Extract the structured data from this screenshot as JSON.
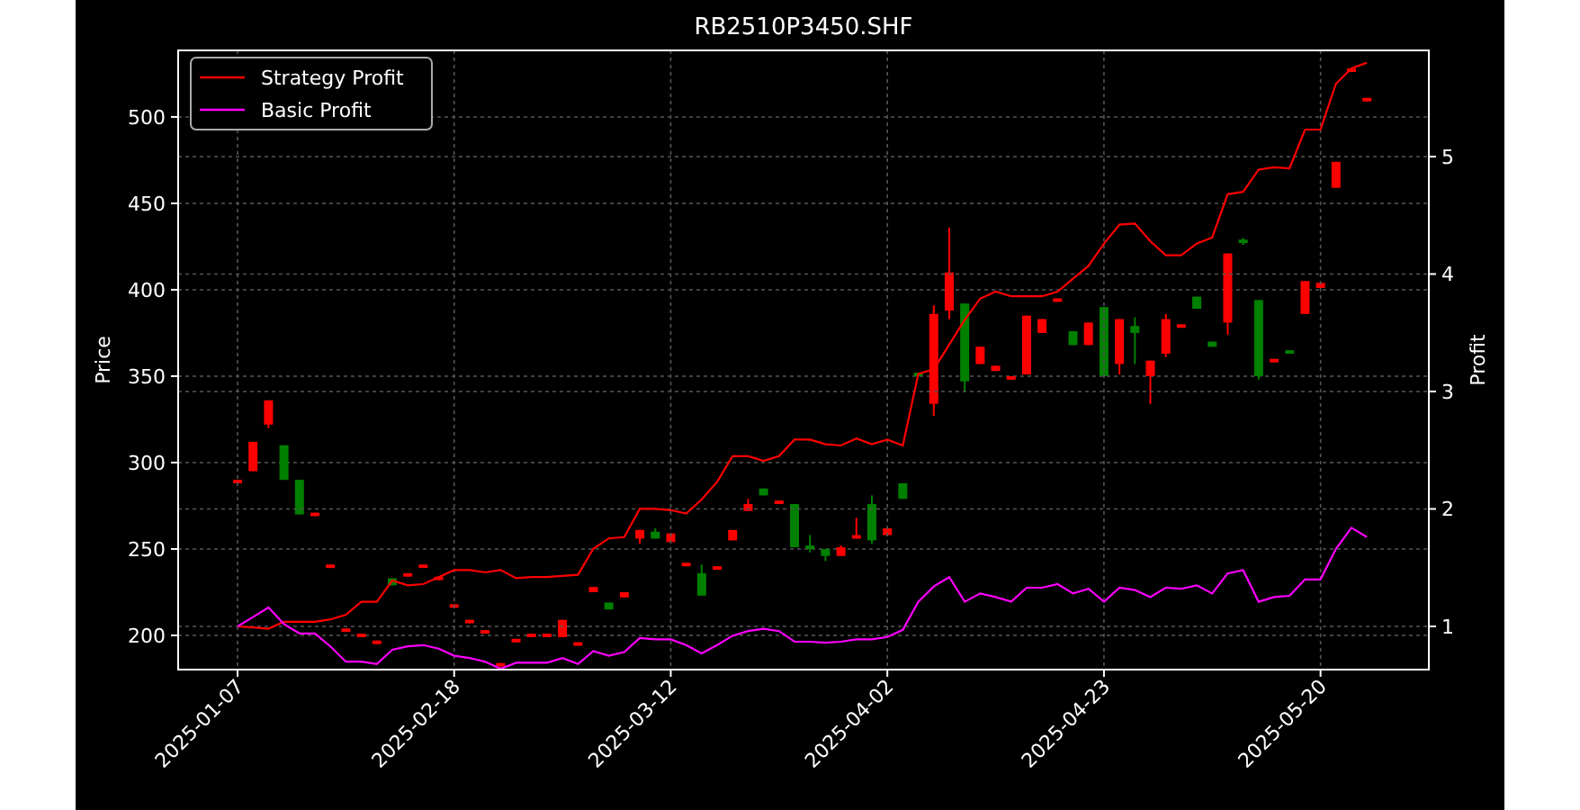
{
  "price_chart": {
    "chart_data": {
      "type": "candlestick",
      "title": "RB2510P3450.SHF",
      "ylabel": "Price",
      "grid": true,
      "categories": [
        null,
        null,
        null,
        null,
        null,
        null,
        null,
        null,
        null,
        null,
        null,
        null,
        null,
        null,
        null,
        null,
        null,
        null,
        null,
        null,
        null,
        null,
        null,
        null,
        null,
        null,
        null,
        null,
        null,
        null,
        null,
        null,
        null,
        null,
        null,
        null,
        null,
        null,
        null,
        null,
        null,
        null,
        null,
        null,
        null,
        null,
        null,
        null,
        null,
        null,
        null,
        null,
        null,
        null,
        null,
        null,
        null,
        null,
        null,
        null,
        null,
        null,
        null,
        null,
        null,
        null,
        null,
        null,
        null,
        null,
        null,
        null,
        null,
        null
      ],
      "ylim": [
        180.2,
        538.5
      ],
      "yticks": [
        200,
        250,
        300,
        350,
        400,
        450,
        500
      ],
      "ohlc": [
        [
          288,
          290,
          288,
          290
        ],
        [
          295,
          312,
          295,
          312
        ],
        [
          322,
          336,
          320,
          336
        ],
        [
          310,
          310,
          290,
          290
        ],
        [
          290,
          290,
          270,
          270
        ],
        [
          269,
          271,
          269,
          271
        ],
        [
          239,
          241,
          239,
          241
        ],
        [
          202,
          204,
          202,
          204
        ],
        [
          199,
          201,
          199,
          201
        ],
        [
          195,
          197,
          195,
          197
        ],
        [
          233,
          233,
          229,
          229
        ],
        [
          234,
          236,
          234,
          236
        ],
        [
          239,
          241,
          239,
          241
        ],
        [
          232,
          234,
          232,
          234
        ],
        [
          216,
          218,
          216,
          218
        ],
        [
          207,
          209,
          207,
          209
        ],
        [
          201,
          203,
          201,
          203
        ],
        [
          182,
          184,
          182,
          184
        ],
        [
          196,
          198,
          196,
          198
        ],
        [
          199,
          201,
          199,
          201
        ],
        [
          199,
          201,
          199,
          201
        ],
        [
          199,
          209,
          199,
          209
        ],
        [
          194,
          196,
          194,
          196
        ],
        [
          225,
          228,
          225,
          228
        ],
        [
          219,
          219,
          215,
          215
        ],
        [
          222,
          225,
          222,
          225
        ],
        [
          256,
          261,
          253,
          261
        ],
        [
          260,
          262,
          256,
          256
        ],
        [
          254,
          259,
          254,
          259
        ],
        [
          240,
          242,
          240,
          242
        ],
        [
          236,
          241,
          223,
          223
        ],
        [
          238,
          240,
          238,
          240
        ],
        [
          255,
          261,
          255,
          261
        ],
        [
          272,
          279,
          272,
          276
        ],
        [
          285,
          285,
          281,
          281
        ],
        [
          276,
          278,
          276,
          278
        ],
        [
          276,
          276,
          251,
          251
        ],
        [
          252,
          258,
          248,
          250
        ],
        [
          250,
          250,
          243,
          246
        ],
        [
          246,
          252,
          246,
          251
        ],
        [
          256,
          268,
          256,
          258
        ],
        [
          276,
          281,
          253,
          255
        ],
        [
          258,
          262,
          258,
          262
        ],
        [
          288,
          288,
          279,
          279
        ],
        [
          352,
          352,
          350,
          350
        ],
        [
          334,
          391,
          327,
          386
        ],
        [
          388,
          436,
          383,
          410
        ],
        [
          392,
          392,
          341,
          347
        ],
        [
          357,
          367,
          357,
          367
        ],
        [
          353,
          356,
          353,
          356
        ],
        [
          348,
          350,
          348,
          350
        ],
        [
          351,
          385,
          351,
          385
        ],
        [
          375,
          383,
          375,
          383
        ],
        [
          393,
          395,
          393,
          395
        ],
        [
          376,
          376,
          368,
          368
        ],
        [
          368,
          381,
          368,
          381
        ],
        [
          390,
          390,
          350,
          350
        ],
        [
          357,
          383,
          351,
          383
        ],
        [
          379,
          384,
          357,
          375
        ],
        [
          350,
          359,
          334,
          359
        ],
        [
          363,
          386,
          361,
          383
        ],
        [
          378,
          380,
          378,
          380
        ],
        [
          396,
          396,
          389,
          389
        ],
        [
          370,
          370,
          367,
          367
        ],
        [
          381,
          421,
          374,
          421
        ],
        [
          429,
          430,
          426,
          427
        ],
        [
          394,
          394,
          348,
          350
        ],
        [
          358,
          360,
          358,
          360
        ],
        [
          365,
          365,
          363,
          363
        ],
        [
          386,
          405,
          386,
          405
        ],
        [
          401,
          404,
          401,
          404
        ],
        [
          459,
          474,
          459,
          474
        ],
        [
          526,
          528,
          526,
          528
        ],
        [
          509,
          511,
          509,
          511
        ]
      ]
    }
  },
  "profit_chart": {
    "chart_data": {
      "type": "line",
      "ylabel": "Profit",
      "grid": true,
      "legend": true,
      "categories": [
        "2025-01-07",
        null,
        null,
        null,
        null,
        null,
        null,
        null,
        null,
        null,
        null,
        null,
        null,
        null,
        "2025-02-18",
        null,
        null,
        null,
        null,
        null,
        null,
        null,
        null,
        null,
        null,
        null,
        null,
        null,
        "2025-03-12",
        null,
        null,
        null,
        null,
        null,
        null,
        null,
        null,
        null,
        null,
        null,
        null,
        null,
        "2025-04-02",
        null,
        null,
        null,
        null,
        null,
        null,
        null,
        null,
        null,
        null,
        null,
        null,
        null,
        "2025-04-23",
        null,
        null,
        null,
        null,
        null,
        null,
        null,
        null,
        null,
        null,
        null,
        null,
        null,
        "2025-05-20",
        null,
        null,
        null
      ],
      "ylim": [
        0.632,
        5.904
      ],
      "yticks": [
        1,
        2,
        3,
        4,
        5
      ],
      "series": [
        {
          "name": "Strategy Profit",
          "color": "#ff0000",
          "values": [
            1.0,
            0.99,
            0.98,
            1.04,
            1.04,
            1.04,
            1.06,
            1.1,
            1.21,
            1.21,
            1.39,
            1.35,
            1.36,
            1.42,
            1.48,
            1.48,
            1.46,
            1.48,
            1.41,
            1.42,
            1.42,
            1.43,
            1.44,
            1.66,
            1.75,
            1.76,
            2.0,
            2.0,
            1.99,
            1.96,
            2.08,
            2.23,
            2.45,
            2.45,
            2.41,
            2.45,
            2.59,
            2.59,
            2.55,
            2.54,
            2.6,
            2.55,
            2.59,
            2.54,
            3.15,
            3.19,
            3.4,
            3.61,
            3.79,
            3.85,
            3.81,
            3.81,
            3.81,
            3.85,
            3.96,
            4.07,
            4.26,
            4.42,
            4.43,
            4.28,
            4.16,
            4.16,
            4.26,
            4.31,
            4.68,
            4.7,
            4.89,
            4.91,
            4.9,
            5.23,
            5.23,
            5.62,
            5.75,
            5.8
          ]
        },
        {
          "name": "Basic Profit",
          "color": "#ff00ff",
          "values": [
            1.0,
            1.08,
            1.16,
            1.02,
            0.94,
            0.94,
            0.83,
            0.7,
            0.7,
            0.68,
            0.8,
            0.83,
            0.84,
            0.81,
            0.75,
            0.73,
            0.7,
            0.64,
            0.69,
            0.69,
            0.69,
            0.73,
            0.68,
            0.79,
            0.75,
            0.78,
            0.9,
            0.89,
            0.89,
            0.84,
            0.77,
            0.84,
            0.92,
            0.96,
            0.98,
            0.96,
            0.87,
            0.87,
            0.86,
            0.87,
            0.89,
            0.89,
            0.91,
            0.97,
            1.21,
            1.34,
            1.42,
            1.21,
            1.28,
            1.25,
            1.21,
            1.33,
            1.33,
            1.36,
            1.28,
            1.32,
            1.21,
            1.33,
            1.31,
            1.25,
            1.33,
            1.32,
            1.35,
            1.28,
            1.45,
            1.48,
            1.21,
            1.25,
            1.26,
            1.4,
            1.4,
            1.66,
            1.84,
            1.76
          ]
        }
      ]
    }
  }
}
